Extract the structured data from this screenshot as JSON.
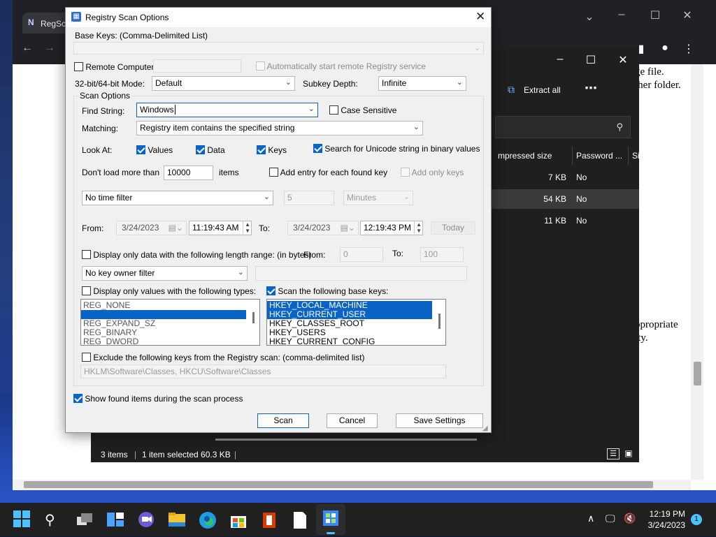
{
  "browser": {
    "tab_title": "RegSc",
    "doc_lines": [
      "ge file.",
      "ther folder."
    ],
    "doc_lines_lower": [
      "ppropriate",
      "ity."
    ]
  },
  "explorer": {
    "extract_all": "Extract all",
    "col_compressed": "mpressed size",
    "col_password": "Password ...",
    "col_size": "Si",
    "rows": [
      {
        "size": "7 KB",
        "password": "No"
      },
      {
        "size": "54 KB",
        "password": "No"
      },
      {
        "size": "11 KB",
        "password": "No"
      }
    ],
    "status_items": "3 items",
    "status_selected": "1 item selected  60.3 KB"
  },
  "dialog": {
    "title": "Registry Scan Options",
    "base_keys_label": "Base Keys:  (Comma-Delimited List)",
    "base_keys_value": "",
    "remote_computer_label": "Remote Computer:",
    "remote_computer_value": "",
    "auto_start_label": "Automatically start remote Registry service",
    "mode_label": "32-bit/64-bit Mode:",
    "mode_value": "Default",
    "subkey_depth_label": "Subkey Depth:",
    "subkey_depth_value": "Infinite",
    "scan_options_label": "Scan Options",
    "find_string_label": "Find String:",
    "find_string_value": "Windows",
    "case_sensitive_label": "Case Sensitive",
    "matching_label": "Matching:",
    "matching_value": "Registry item contains the specified string",
    "look_at_label": "Look At:",
    "values_label": "Values",
    "data_label": "Data",
    "keys_label": "Keys",
    "unicode_label": "Search for Unicode string in binary values",
    "dont_load_label": "Don't load more than",
    "dont_load_value": "10000",
    "items_label": "items",
    "add_entry_label": "Add entry for each found key",
    "add_only_keys_label": "Add only keys",
    "time_filter_value": "No time filter",
    "time_amount": "5",
    "time_unit": "Minutes",
    "from_label": "From:",
    "from_date": "3/24/2023",
    "from_time": "11:19:43 AM",
    "to_label": "To:",
    "to_date": "3/24/2023",
    "to_time": "12:19:43 PM",
    "today_label": "Today",
    "length_range_label": "Display only data with the following length range: (in bytes)",
    "length_from_label": "From:",
    "length_from_value": "0",
    "length_to_label": "To:",
    "length_to_value": "100",
    "owner_filter_value": "No key owner filter",
    "types_label": "Display only values with the following types:",
    "types": [
      "REG_NONE",
      "",
      "REG_EXPAND_SZ",
      "REG_BINARY",
      "REG_DWORD"
    ],
    "base_keys_scan_label": "Scan the following base keys:",
    "base_keys_list": [
      "HKEY_LOCAL_MACHINE",
      "HKEY_CURRENT_USER",
      "HKEY_CLASSES_ROOT",
      "HKEY_USERS",
      "HKEY_CURRENT_CONFIG"
    ],
    "exclude_label": "Exclude the following keys from the Registry scan: (comma-delimited list)",
    "exclude_value": "HKLM\\Software\\Classes, HKCU\\Software\\Classes",
    "show_found_label": "Show found items during the scan process",
    "scan_button": "Scan",
    "cancel_button": "Cancel",
    "save_settings_button": "Save Settings"
  },
  "taskbar": {
    "time": "12:19 PM",
    "date": "3/24/2023",
    "notification_count": "1"
  },
  "colors": {
    "accent": "#0a64c8",
    "dialog_bg": "#f0f0f0",
    "taskbar_bg": "#202020",
    "explorer_bg": "#1f1f1f"
  }
}
